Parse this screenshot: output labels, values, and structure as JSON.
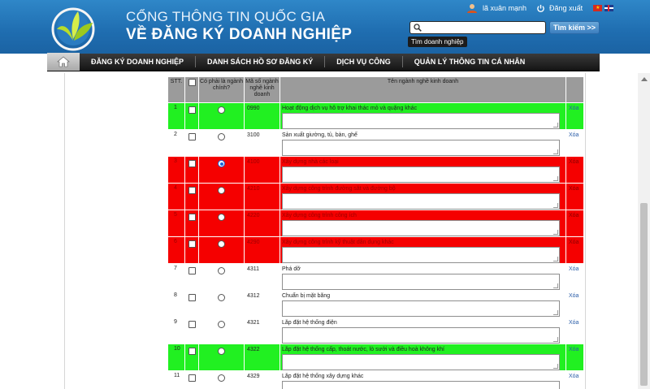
{
  "header": {
    "line1": "CỔNG THÔNG TIN QUỐC GIA",
    "line2": "VỀ ĐĂNG KÝ DOANH NGHIỆP",
    "user_name": "lã xuân mạnh",
    "logout_label": "Đăng xuất"
  },
  "search": {
    "placeholder": "",
    "button_label": "Tìm kiếm >>",
    "tooltip": "Tìm doanh nghiệp"
  },
  "nav": {
    "items": [
      "ĐĂNG KÝ DOANH NGHIỆP",
      "DANH SÁCH HỒ SƠ ĐĂNG KÝ",
      "DỊCH VỤ CÔNG",
      "QUẢN LÝ THÔNG TIN CÁ NHÂN"
    ]
  },
  "table": {
    "headers": {
      "stt": "STT.",
      "main": "Có phải là ngành chính?",
      "code": "Mã số ngành nghề kinh doanh",
      "name": "Tên ngành nghề kinh doanh"
    },
    "delete_label": "Xóa",
    "rows": [
      {
        "stt": "1",
        "code": "0990",
        "name": "Hoạt động dịch vụ hỗ trợ khai thác mỏ và quặng khác",
        "status": "green",
        "main": false
      },
      {
        "stt": "2",
        "code": "3100",
        "name": "Sản xuất giường, tủ, bàn, ghế",
        "status": "white",
        "main": false
      },
      {
        "stt": "3",
        "code": "4100",
        "name": "Xây dựng nhà các loại",
        "status": "red",
        "main": true
      },
      {
        "stt": "4",
        "code": "4210",
        "name": "Xây dựng công trình đường sắt và đường bộ",
        "status": "red",
        "main": false
      },
      {
        "stt": "5",
        "code": "4220",
        "name": "Xây dựng công trình công ích",
        "status": "red",
        "main": false
      },
      {
        "stt": "6",
        "code": "4290",
        "name": "Xây dựng công trình kỹ thuật dân dụng khác",
        "status": "red",
        "main": false
      },
      {
        "stt": "7",
        "code": "4311",
        "name": "Phá dỡ",
        "status": "white",
        "main": false
      },
      {
        "stt": "8",
        "code": "4312",
        "name": "Chuẩn bị mặt bằng",
        "status": "white",
        "main": false
      },
      {
        "stt": "9",
        "code": "4321",
        "name": "Lắp đặt hệ thống điện",
        "status": "white",
        "main": false
      },
      {
        "stt": "10",
        "code": "4322",
        "name": "Lắp đặt hệ thống cấp, thoát nước, lò sưởi và điều hoà không khí",
        "status": "green",
        "main": false
      },
      {
        "stt": "11",
        "code": "4329",
        "name": "Lắp đặt hệ thống xây dựng khác",
        "status": "white",
        "main": false
      }
    ]
  },
  "colors": {
    "header_blue": "#1f6db0",
    "row_green": "#21f021",
    "row_red": "#f50000",
    "header_gray": "#9b9b9b"
  },
  "icons": [
    "logo-icon",
    "user-icon",
    "power-icon",
    "flag-vn-icon",
    "flag-en-icon",
    "search-icon",
    "home-icon"
  ]
}
